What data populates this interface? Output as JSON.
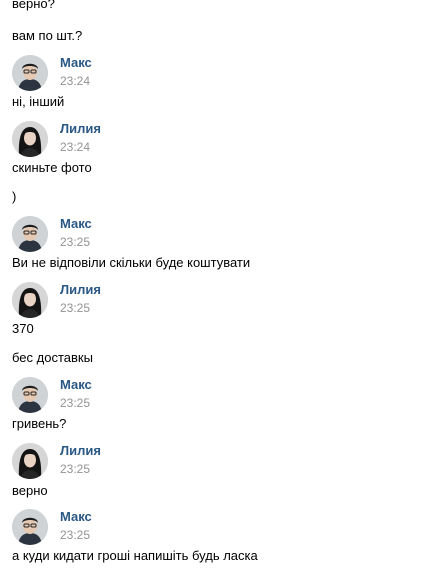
{
  "messages": [
    {
      "text": "верно?"
    },
    {
      "text": "вам по шт.?"
    },
    {
      "author": "Макс",
      "time": "23:24",
      "text": "ні, інший"
    },
    {
      "author": "Лилия",
      "time": "23:24",
      "text": "скиньте фото"
    },
    {
      "text": ")"
    },
    {
      "author": "Макс",
      "time": "23:25",
      "text": "Ви не відповіли скільки буде коштувати"
    },
    {
      "author": "Лилия",
      "time": "23:25",
      "text": "370"
    },
    {
      "text": "бес доставкы"
    },
    {
      "author": "Макс",
      "time": "23:25",
      "text": "гривень?"
    },
    {
      "author": "Лилия",
      "time": "23:25",
      "text": "верно"
    },
    {
      "author": "Макс",
      "time": "23:25",
      "text": "а куди кидати гроші напишіть будь ласка"
    }
  ],
  "colors": {
    "author_link": "#2a5885",
    "timestamp": "#939393",
    "text": "#000000",
    "background": "#ffffff"
  }
}
